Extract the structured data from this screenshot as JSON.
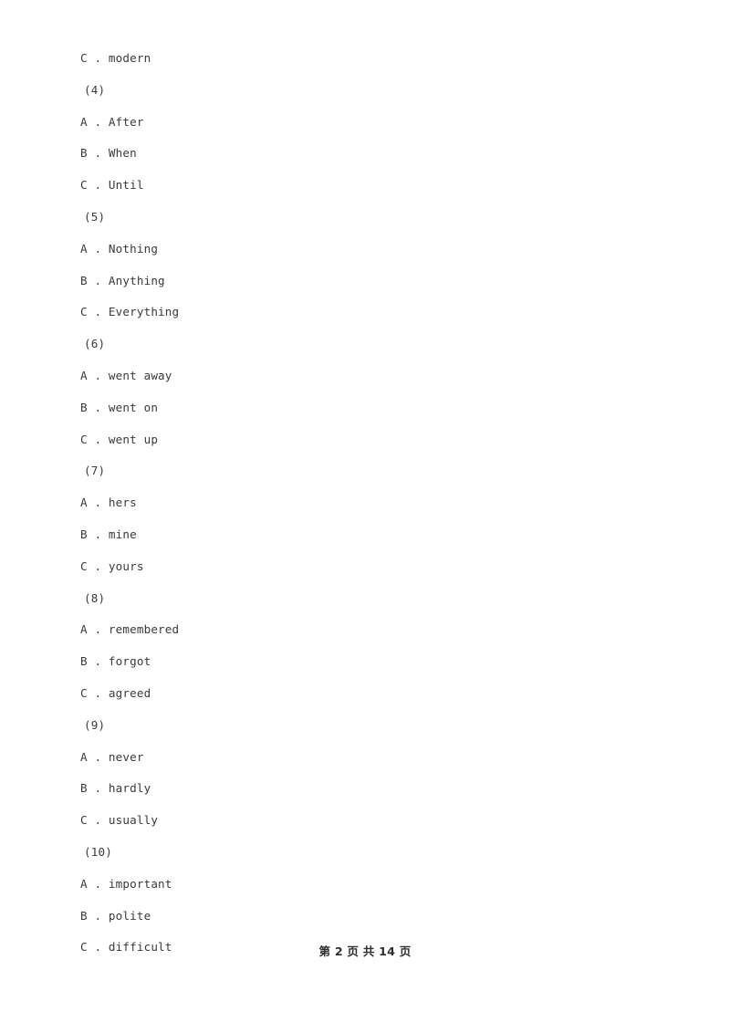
{
  "document": {
    "background_color": "#ffffff",
    "text_color": "#3a3a3a",
    "footer_text_color": "#2e2e2e"
  },
  "body_lines": [
    {
      "kind": "option",
      "text": "C . modern"
    },
    {
      "kind": "qnum",
      "text": "(4)"
    },
    {
      "kind": "option",
      "text": "A . After"
    },
    {
      "kind": "option",
      "text": "B . When"
    },
    {
      "kind": "option",
      "text": "C . Until"
    },
    {
      "kind": "qnum",
      "text": "(5)"
    },
    {
      "kind": "option",
      "text": "A . Nothing"
    },
    {
      "kind": "option",
      "text": "B . Anything"
    },
    {
      "kind": "option",
      "text": "C . Everything"
    },
    {
      "kind": "qnum",
      "text": "(6)"
    },
    {
      "kind": "option",
      "text": "A . went away"
    },
    {
      "kind": "option",
      "text": "B . went on"
    },
    {
      "kind": "option",
      "text": "C . went up"
    },
    {
      "kind": "qnum",
      "text": "(7)"
    },
    {
      "kind": "option",
      "text": "A . hers"
    },
    {
      "kind": "option",
      "text": "B . mine"
    },
    {
      "kind": "option",
      "text": "C . yours"
    },
    {
      "kind": "qnum",
      "text": "(8)"
    },
    {
      "kind": "option",
      "text": "A . remembered"
    },
    {
      "kind": "option",
      "text": "B . forgot"
    },
    {
      "kind": "option",
      "text": "C . agreed"
    },
    {
      "kind": "qnum",
      "text": "(9)"
    },
    {
      "kind": "option",
      "text": "A . never"
    },
    {
      "kind": "option",
      "text": "B . hardly"
    },
    {
      "kind": "option",
      "text": "C . usually"
    },
    {
      "kind": "qnum",
      "text": "(10)"
    },
    {
      "kind": "option",
      "text": "A . important"
    },
    {
      "kind": "option",
      "text": "B . polite"
    },
    {
      "kind": "option",
      "text": "C . difficult"
    }
  ],
  "footer": {
    "text": "第 2 页 共 14 页",
    "current_page": "2",
    "total_pages": "14"
  }
}
